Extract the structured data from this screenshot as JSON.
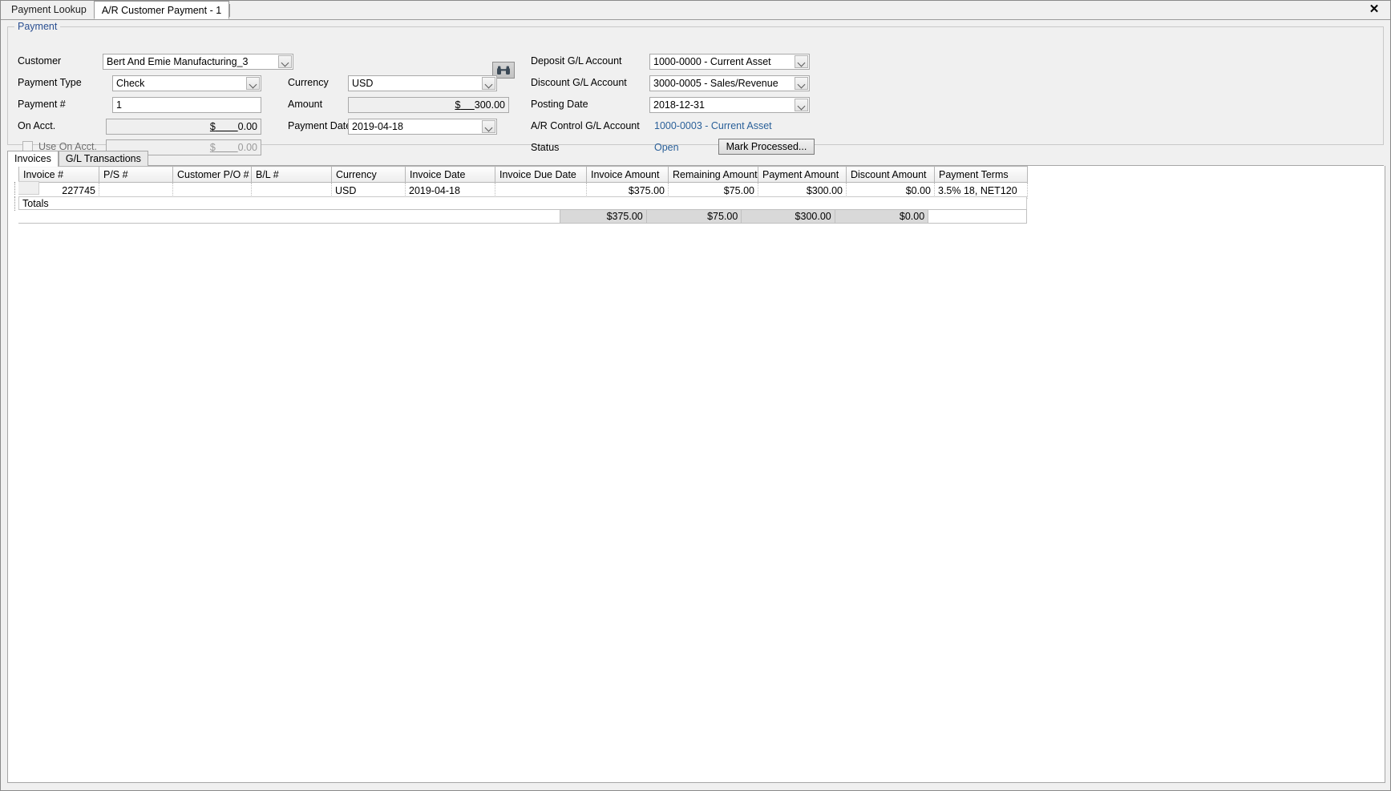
{
  "window": {
    "close_label": "✕",
    "tabs": [
      {
        "label": "Payment Lookup",
        "active": false
      },
      {
        "label": "A/R Customer Payment - 1",
        "active": true
      }
    ]
  },
  "payment_group": {
    "title": "Payment",
    "fields": {
      "customer_label": "Customer",
      "customer_value": "Bert And Emie Manufacturing_3",
      "lookup_icon": "binoculars-icon",
      "payment_type_label": "Payment Type",
      "payment_type_value": "Check",
      "payment_number_label": "Payment #",
      "payment_number_value": "1",
      "on_acct_label": "On Acct.",
      "on_acct_currency": "$",
      "on_acct_value": "0.00",
      "use_on_acct_label": "Use On Acct.",
      "use_on_acct_checked": false,
      "use_on_acct_currency": "$",
      "use_on_acct_value": "0.00",
      "currency_label": "Currency",
      "currency_value": "USD",
      "amount_label": "Amount",
      "amount_currency": "$",
      "amount_value": "300.00",
      "payment_date_label": "Payment Date",
      "payment_date_value": "2019-04-18",
      "deposit_gl_label": "Deposit G/L Account",
      "deposit_gl_value": "1000-0000 - Current Asset",
      "discount_gl_label": "Discount G/L Account",
      "discount_gl_value": "3000-0005 - Sales/Revenue",
      "posting_date_label": "Posting Date",
      "posting_date_value": "2018-12-31",
      "ar_control_gl_label": "A/R Control G/L Account",
      "ar_control_gl_value": "1000-0003 - Current Asset",
      "status_label": "Status",
      "status_value": "Open",
      "mark_processed_label": "Mark Processed..."
    }
  },
  "detail_tabs": [
    {
      "label": "Invoices",
      "active": true
    },
    {
      "label": "G/L Transactions",
      "active": false
    }
  ],
  "grid": {
    "columns": [
      "Invoice #",
      "P/S #",
      "Customer P/O #",
      "B/L #",
      "Currency",
      "Invoice Date",
      "Invoice Due Date",
      "Invoice Amount",
      "Remaining Amount",
      "Payment Amount",
      "Discount Amount",
      "Payment Terms"
    ],
    "rows": [
      {
        "invoice_no": "227745",
        "ps_no": "",
        "customer_po": "",
        "bl_no": "",
        "currency": "USD",
        "invoice_date": "2019-04-18",
        "invoice_due_date": "",
        "invoice_amount": "$375.00",
        "remaining_amount": "$75.00",
        "payment_amount": "$300.00",
        "discount_amount": "$0.00",
        "payment_terms": "3.5% 18, NET120"
      }
    ],
    "totals": {
      "label": "Totals",
      "invoice_amount": "$375.00",
      "remaining_amount": "$75.00",
      "payment_amount": "$300.00",
      "discount_amount": "$0.00",
      "payment_terms": ""
    }
  },
  "colors": {
    "link": "#2a6099",
    "group_title": "#2a4f91",
    "window_bg": "#f0f0f0",
    "totals_bg": "#d9d9d9"
  }
}
